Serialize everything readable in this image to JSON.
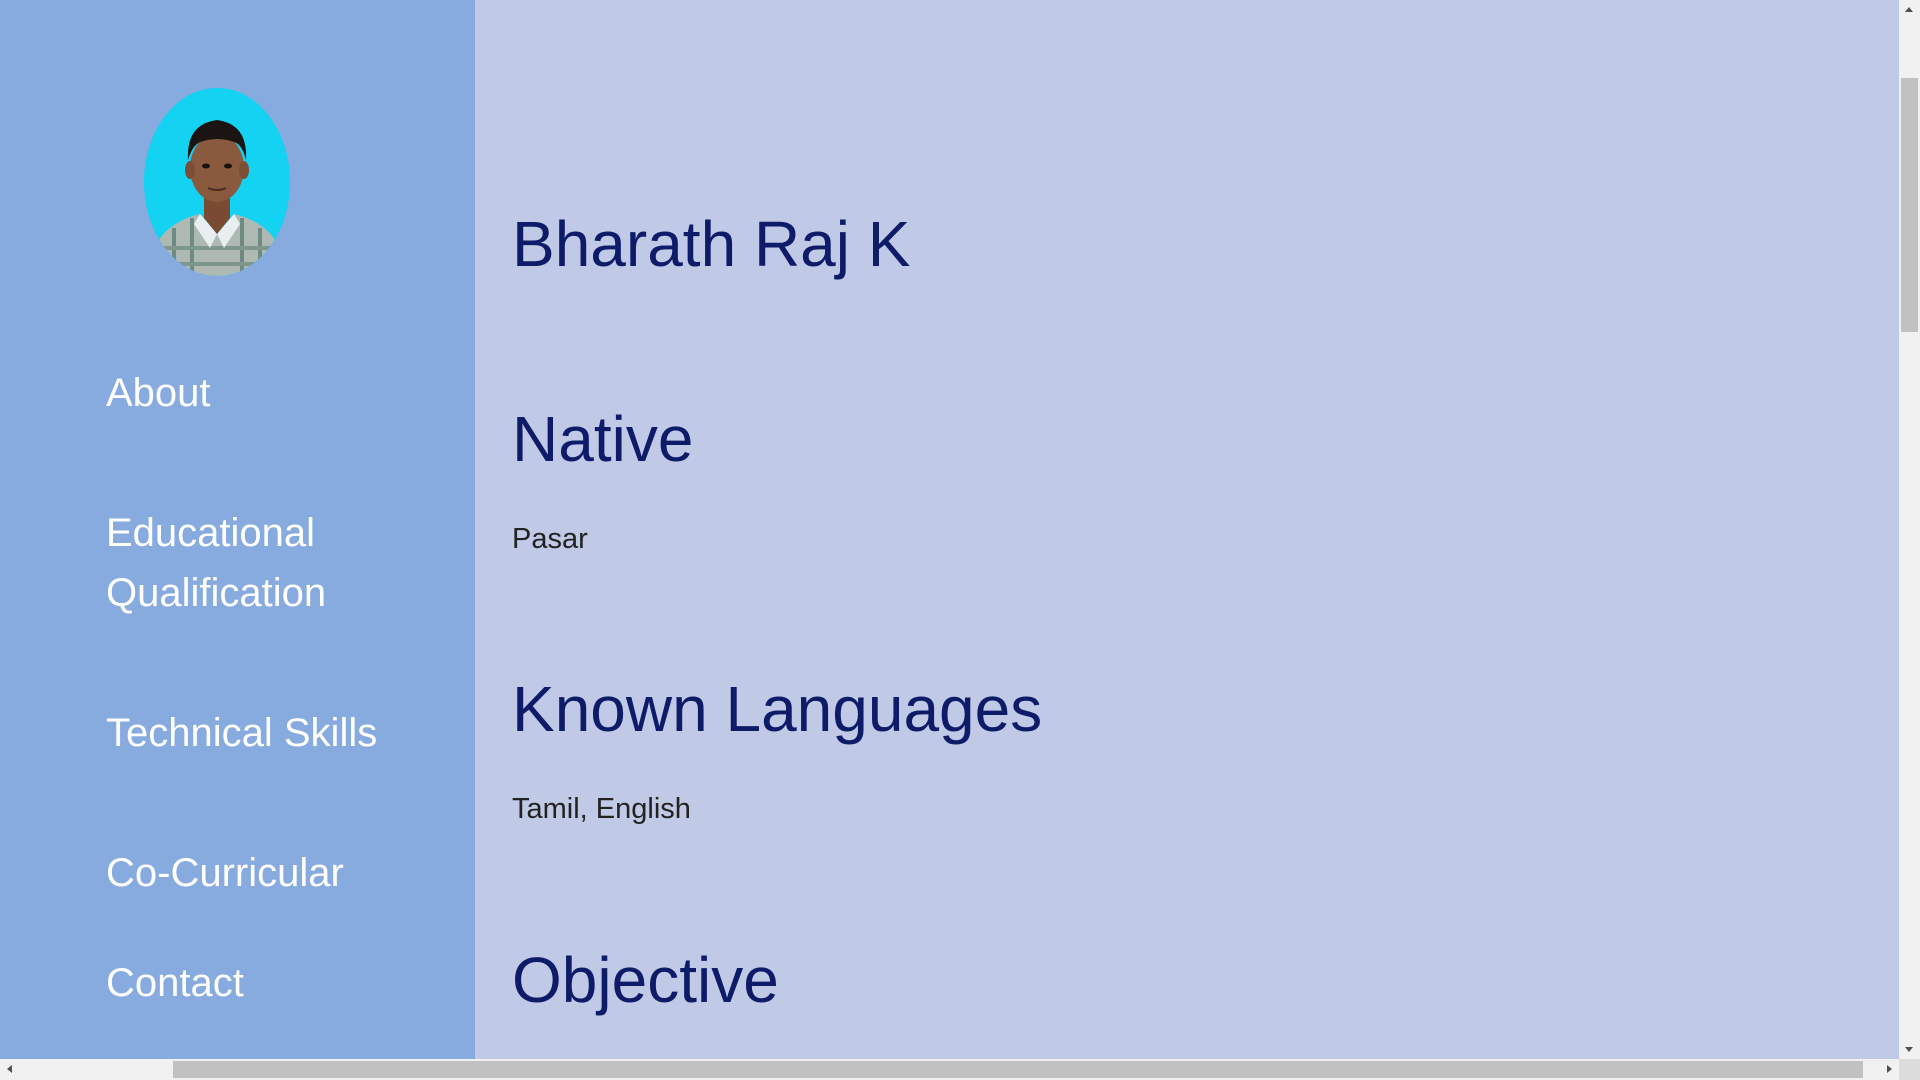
{
  "sidebar": {
    "avatar_icon": "profile-photo",
    "nav": [
      {
        "label": "About"
      },
      {
        "label": "Educational Qualification"
      },
      {
        "label": "Technical Skills"
      },
      {
        "label": "Co-Curricular"
      },
      {
        "label": "Contact"
      }
    ]
  },
  "main": {
    "name": "Bharath Raj K",
    "sections": [
      {
        "heading": "Native",
        "value": "Pasar"
      },
      {
        "heading": "Known Languages",
        "value": "Tamil, English"
      },
      {
        "heading": "Objective"
      }
    ]
  },
  "colors": {
    "sidebar_bg": "#87aadf",
    "main_bg": "#c0c9e5",
    "heading": "#0d1b68",
    "nav_text": "#ffffff",
    "avatar_bg": "#14d2f2"
  }
}
